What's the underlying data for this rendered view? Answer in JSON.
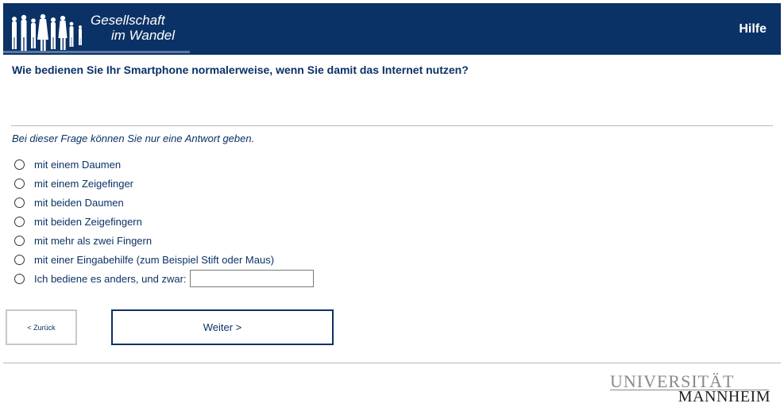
{
  "header": {
    "logo_line1": "Gesellschaft",
    "logo_line2": "im Wandel",
    "help_label": "Hilfe",
    "background_color": "#0b3266"
  },
  "survey": {
    "question": "Wie bedienen Sie Ihr Smartphone normalerweise, wenn Sie damit das Internet nutzen?",
    "instruction": "Bei dieser Frage können Sie nur eine Antwort geben.",
    "options": [
      "mit einem Daumen",
      "mit einem Zeigefinger",
      "mit beiden Daumen",
      "mit beiden Zeigefingern",
      "mit mehr als zwei Fingern",
      "mit einer Eingabehilfe (zum Beispiel Stift oder Maus)",
      "Ich bediene es anders, und zwar:"
    ],
    "other_value": ""
  },
  "navigation": {
    "back_label": "< Zurück",
    "next_label": "Weiter >"
  },
  "footer": {
    "university_line1": "UNIVERSITÄT",
    "university_line2": "MANNHEIM"
  }
}
